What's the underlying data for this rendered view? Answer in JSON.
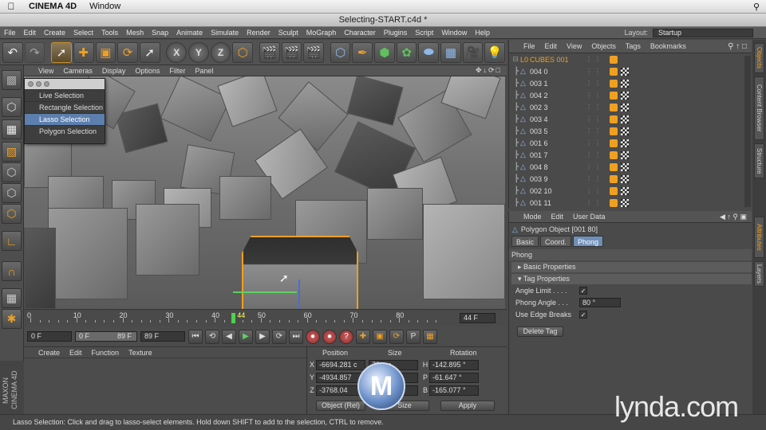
{
  "mac_menu": {
    "apple": "",
    "app": "CINEMA 4D",
    "window": "Window"
  },
  "window_title": "Selecting-START.c4d *",
  "menu": [
    "File",
    "Edit",
    "Create",
    "Select",
    "Tools",
    "Mesh",
    "Snap",
    "Animate",
    "Simulate",
    "Render",
    "Sculpt",
    "MoGraph",
    "Character",
    "Plugins",
    "Script",
    "Window",
    "Help"
  ],
  "layout": {
    "label": "Layout:",
    "value": "Startup"
  },
  "toolbar_icons": [
    "undo-icon",
    "redo-icon",
    "live-selection-icon",
    "move-icon",
    "scale-icon",
    "rotate-icon",
    "recent-tool-icon",
    "x-axis-icon",
    "y-axis-icon",
    "z-axis-icon",
    "coordinate-system-icon",
    "render-view-icon",
    "render-picture-viewer-icon",
    "render-settings-icon",
    "cube-icon",
    "pen-icon",
    "subdivision-icon",
    "cloner-icon",
    "deformer-icon",
    "floor-icon",
    "camera-icon",
    "light-icon"
  ],
  "viewport_menu": [
    "View",
    "Cameras",
    "Display",
    "Options",
    "Filter",
    "Panel"
  ],
  "selection_popup": {
    "items": [
      "Live Selection",
      "Rectangle Selection",
      "Lasso Selection",
      "Polygon Selection"
    ],
    "selected": "Lasso Selection"
  },
  "timeline": {
    "ticks": [
      "0",
      "10",
      "20",
      "30",
      "40",
      "50",
      "60",
      "70",
      "80"
    ],
    "current_frame": "44",
    "end_frame_display": "44 F",
    "max": 90
  },
  "transport": {
    "start": "0 F",
    "min": "0 F",
    "max": "89 F",
    "end": "89 F"
  },
  "timeline_panel_menu": [
    "Create",
    "Edit",
    "Function",
    "Texture"
  ],
  "coords": {
    "headers": {
      "position": "Position",
      "size": "Size",
      "rotation": "Rotation"
    },
    "rows": [
      {
        "axis": "X",
        "pos": "-6694.281 c",
        "size": "79 cm",
        "rot_axis": "H",
        "rot": "-142.895 °"
      },
      {
        "axis": "Y",
        "pos": "-4934.857",
        "size": "79 cm",
        "rot_axis": "P",
        "rot": "-61.647 °"
      },
      {
        "axis": "Z",
        "pos": "-3768.04",
        "size": "79 cm",
        "rot_axis": "B",
        "rot": "-165.077 °"
      }
    ],
    "mode": "Object (Rel)",
    "size_mode": "Size",
    "apply": "Apply"
  },
  "status": "Lasso Selection: Click and drag to lasso-select elements. Hold down SHIFT to add to the selection, CTRL to remove.",
  "object_manager": {
    "menu": [
      "File",
      "Edit",
      "View",
      "Objects",
      "Tags",
      "Bookmarks"
    ],
    "root": "CUBES 001",
    "objects": [
      "004 0",
      "003 1",
      "004 2",
      "002 3",
      "003 4",
      "003 5",
      "001 6",
      "001 7",
      "004 8",
      "003 9",
      "002 10",
      "001 11"
    ]
  },
  "attribute_manager": {
    "menu": [
      "Mode",
      "Edit",
      "User Data"
    ],
    "title": "Polygon Object [001 80]",
    "tabs": [
      "Basic",
      "Coord.",
      "Phong"
    ],
    "active_tab": "Phong",
    "section": "Phong",
    "groups": [
      "Basic Properties",
      "Tag Properties"
    ],
    "props": [
      {
        "label": "Angle Limit . . . .",
        "type": "check",
        "value": "✓"
      },
      {
        "label": "Phong Angle . . .",
        "type": "num",
        "value": "80 °"
      },
      {
        "label": "Use Edge Breaks",
        "type": "check",
        "value": "✓"
      }
    ],
    "delete_tag": "Delete Tag"
  },
  "right_tabs": [
    "Objects",
    "Content Browser",
    "Structure",
    "Attributes",
    "Layers"
  ],
  "side_brand": "MAXON CINEMA 4D",
  "watermark": "lynda.com",
  "colors": {
    "accent": "#f0a020",
    "selection": "#5c7fae"
  }
}
